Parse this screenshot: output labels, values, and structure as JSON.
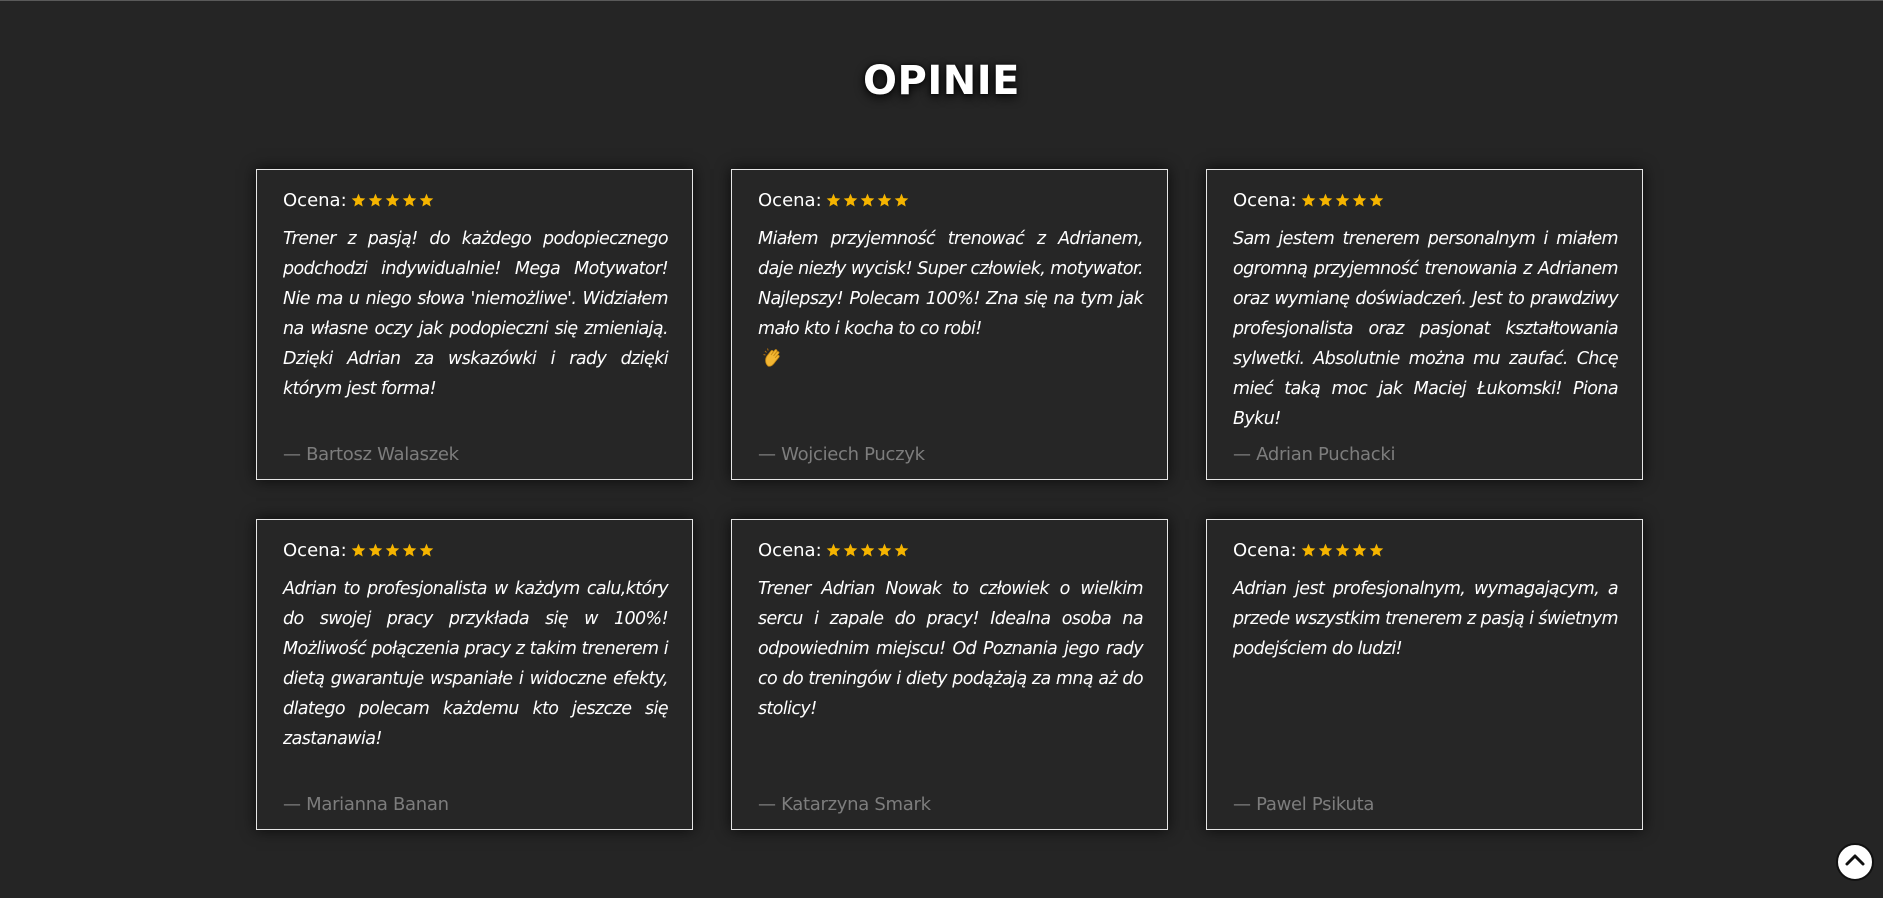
{
  "section": {
    "title": "OPINIE"
  },
  "rating_label": "Ocena:",
  "star_color": "#f5b400",
  "reviews": [
    {
      "rating": 5,
      "text": "Trener z pasją! do każdego podopiecznego podchodzi indywidualnie! Mega Motywator! Nie ma u niego słowa 'niemożliwe'. Widziałem na własne oczy jak podopieczni się zmieniają. Dzięki Adrian za wskazówki i rady dzięki którym jest forma!",
      "author": "— Bartosz Walaszek"
    },
    {
      "rating": 5,
      "text": "Miałem przyjemność trenować z Adrianem, daje niezły wycisk! Super człowiek, motywator. Najlepszy! Polecam 100%! Zna się na tym jak mało kto i kocha to co robi!",
      "emoji": "clapping-hands-icon",
      "author": "— Wojciech Puczyk"
    },
    {
      "rating": 5,
      "text": "Sam jestem trenerem personalnym i miałem ogromną przyjemność trenowania z Adrianem oraz wymianę doświadczeń. Jest to prawdziwy profesjonalista oraz pasjonat kształtowania sylwetki. Absolutnie można mu zaufać. Chcę mieć taką moc jak Maciej Łukomski! Piona Byku!",
      "author": "— Adrian Puchacki"
    },
    {
      "rating": 5,
      "text": "Adrian to profesjonalista w każdym calu,który do swojej pracy przykłada się w 100%! Możliwość połączenia pracy z takim trenerem i dietą gwarantuje wspaniałe i widoczne efekty, dlatego polecam każdemu kto jeszcze się zastanawia!",
      "author": "— Marianna Banan"
    },
    {
      "rating": 5,
      "text": "Trener Adrian Nowak to człowiek o wielkim sercu i zapale do pracy! Idealna osoba na odpowiednim miejscu! Od Poznania jego rady co do treningów i diety podążają za mną aż do stolicy!",
      "author": "— Katarzyna Smark"
    },
    {
      "rating": 5,
      "text": "Adrian jest profesjonalnym, wymagającym, a przede wszystkim trenerem z pasją i świetnym podejściem do ludzi!",
      "author": "— Pawel Psikuta"
    }
  ],
  "scroll_top_icon": "chevron-up-icon"
}
